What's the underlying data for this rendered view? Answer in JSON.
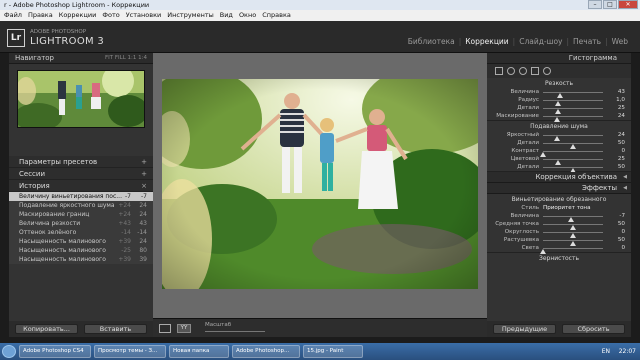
{
  "window": {
    "title": "r - Adobe Photoshop Lightroom - Коррекции"
  },
  "menu": [
    "Файл",
    "Правка",
    "Коррекции",
    "Фото",
    "Установки",
    "Инструменты",
    "Вид",
    "Окно",
    "Справка"
  ],
  "brand": {
    "logo": "Lr",
    "line1": "ADOBE PHOTOSHOP",
    "line2": "LIGHTROOM 3"
  },
  "modules": [
    "Библиотека",
    "Коррекции",
    "Слайд-шоу",
    "Печать",
    "Web"
  ],
  "active_module": "Коррекции",
  "left": {
    "navigator": {
      "title": "Навигатор",
      "opts": "FIT  FILL  1:1  1:4"
    },
    "presets": "Параметры пресетов",
    "sessions": "Сессии",
    "history_title": "История",
    "history": [
      {
        "label": "Величину виньетирования пос...",
        "a": "-7",
        "b": "-7",
        "selected": true
      },
      {
        "label": "Подавление яркостного шума",
        "a": "+24",
        "b": "24"
      },
      {
        "label": "Маскирование границ",
        "a": "+24",
        "b": "24"
      },
      {
        "label": "Величина резкости",
        "a": "+43",
        "b": "43"
      },
      {
        "label": "Оттенок зелёного",
        "a": "-14",
        "b": "-14"
      },
      {
        "label": "Насыщенность малинового",
        "a": "+39",
        "b": "24"
      },
      {
        "label": "Насыщенность малинового",
        "a": "-25",
        "b": "80"
      },
      {
        "label": "Насыщенность малинового",
        "a": "+39",
        "b": "39"
      }
    ],
    "btn_copy": "Копировать...",
    "btn_paste": "Вставить"
  },
  "toolbar": {
    "zoom_label": "Масштаб"
  },
  "right": {
    "histogram_title": "Гистограмма",
    "sharpening": {
      "title": "Резкость",
      "sliders": [
        {
          "label": "Величина",
          "value": "43",
          "pos": 0.29
        },
        {
          "label": "Радиус",
          "value": "1,0",
          "pos": 0.25
        },
        {
          "label": "Детали",
          "value": "25",
          "pos": 0.25
        },
        {
          "label": "Маскирование",
          "value": "24",
          "pos": 0.24
        }
      ]
    },
    "noise": {
      "title": "Подавление шума",
      "sliders": [
        {
          "label": "Яркостный",
          "value": "24",
          "pos": 0.24
        },
        {
          "label": "Детали",
          "value": "50",
          "pos": 0.5
        },
        {
          "label": "Контраст",
          "value": "0",
          "pos": 0.0
        },
        {
          "label": "Цветовой",
          "value": "25",
          "pos": 0.25
        },
        {
          "label": "Детали",
          "value": "50",
          "pos": 0.5
        }
      ]
    },
    "lens_title": "Коррекция объектива",
    "effects_title": "Эффекты",
    "vignette": {
      "title": "Виньетирование обрезанного",
      "style_label": "Стиль",
      "style_value": "Приоритет тона",
      "sliders": [
        {
          "label": "Величина",
          "value": "-7",
          "pos": 0.465
        },
        {
          "label": "Средняя точка",
          "value": "50",
          "pos": 0.5
        },
        {
          "label": "Округлость",
          "value": "0",
          "pos": 0.5
        },
        {
          "label": "Растушевка",
          "value": "50",
          "pos": 0.5
        },
        {
          "label": "Света",
          "value": "0",
          "pos": 0.0
        }
      ]
    },
    "grain_title": "Зернистость",
    "btn_prev": "Предыдущие",
    "btn_reset": "Сбросить"
  },
  "taskbar": {
    "items": [
      "Adobe Photoshop CS4",
      "Просмотр темы - З...",
      "Новая папка",
      "Adobe Photoshop...",
      "15.jpg - Paint"
    ],
    "lang": "EN",
    "clock": "22:07"
  }
}
